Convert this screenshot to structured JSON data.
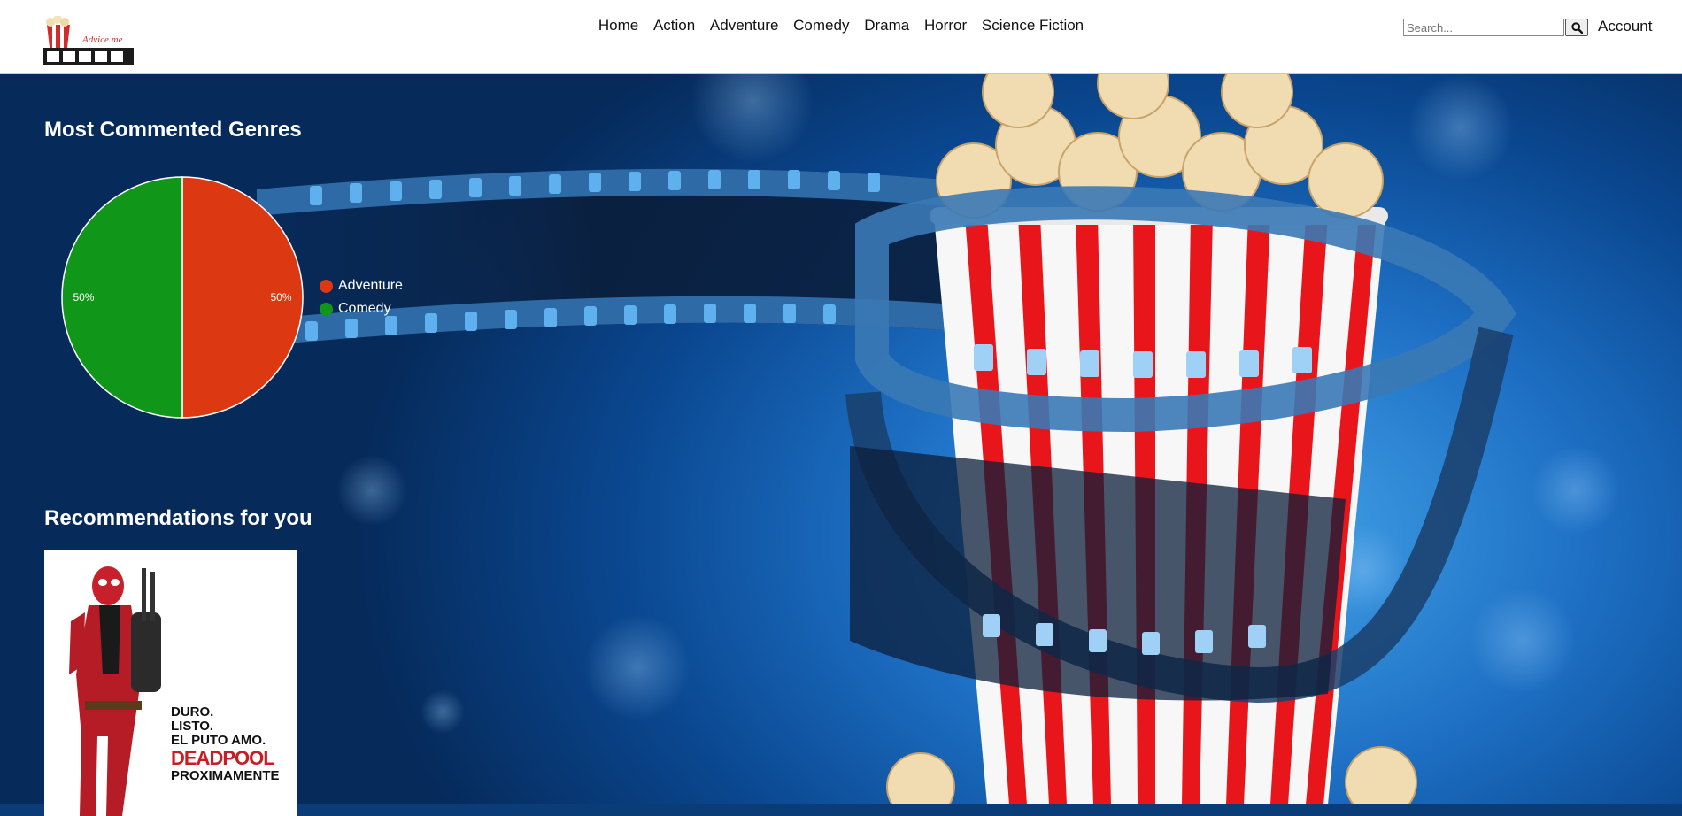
{
  "header": {
    "logo_text": "Advice.me",
    "nav": [
      "Home",
      "Action",
      "Adventure",
      "Comedy",
      "Drama",
      "Horror",
      "Science Fiction"
    ],
    "search_placeholder": "Search...",
    "account_label": "Account"
  },
  "genres_section": {
    "title": "Most Commented Genres",
    "chart_data": {
      "type": "pie",
      "title": "",
      "series": [
        {
          "name": "Adventure",
          "value": 50,
          "label": "50%",
          "color": "#dc3912"
        },
        {
          "name": "Comedy",
          "value": 50,
          "label": "50%",
          "color": "#109618"
        }
      ],
      "legend_position": "right"
    }
  },
  "recommendations": {
    "title": "Recommendations for you",
    "items": [
      {
        "poster_lines": [
          "DURO.",
          "LISTO.",
          "EL PUTO AMO.",
          "DEADPOOL",
          "PROXIMAMENTE"
        ]
      }
    ]
  },
  "colors": {
    "header_bg": "#ffffff",
    "hero_blue": "#1d6fc4",
    "popcorn_red": "#e8161b"
  }
}
